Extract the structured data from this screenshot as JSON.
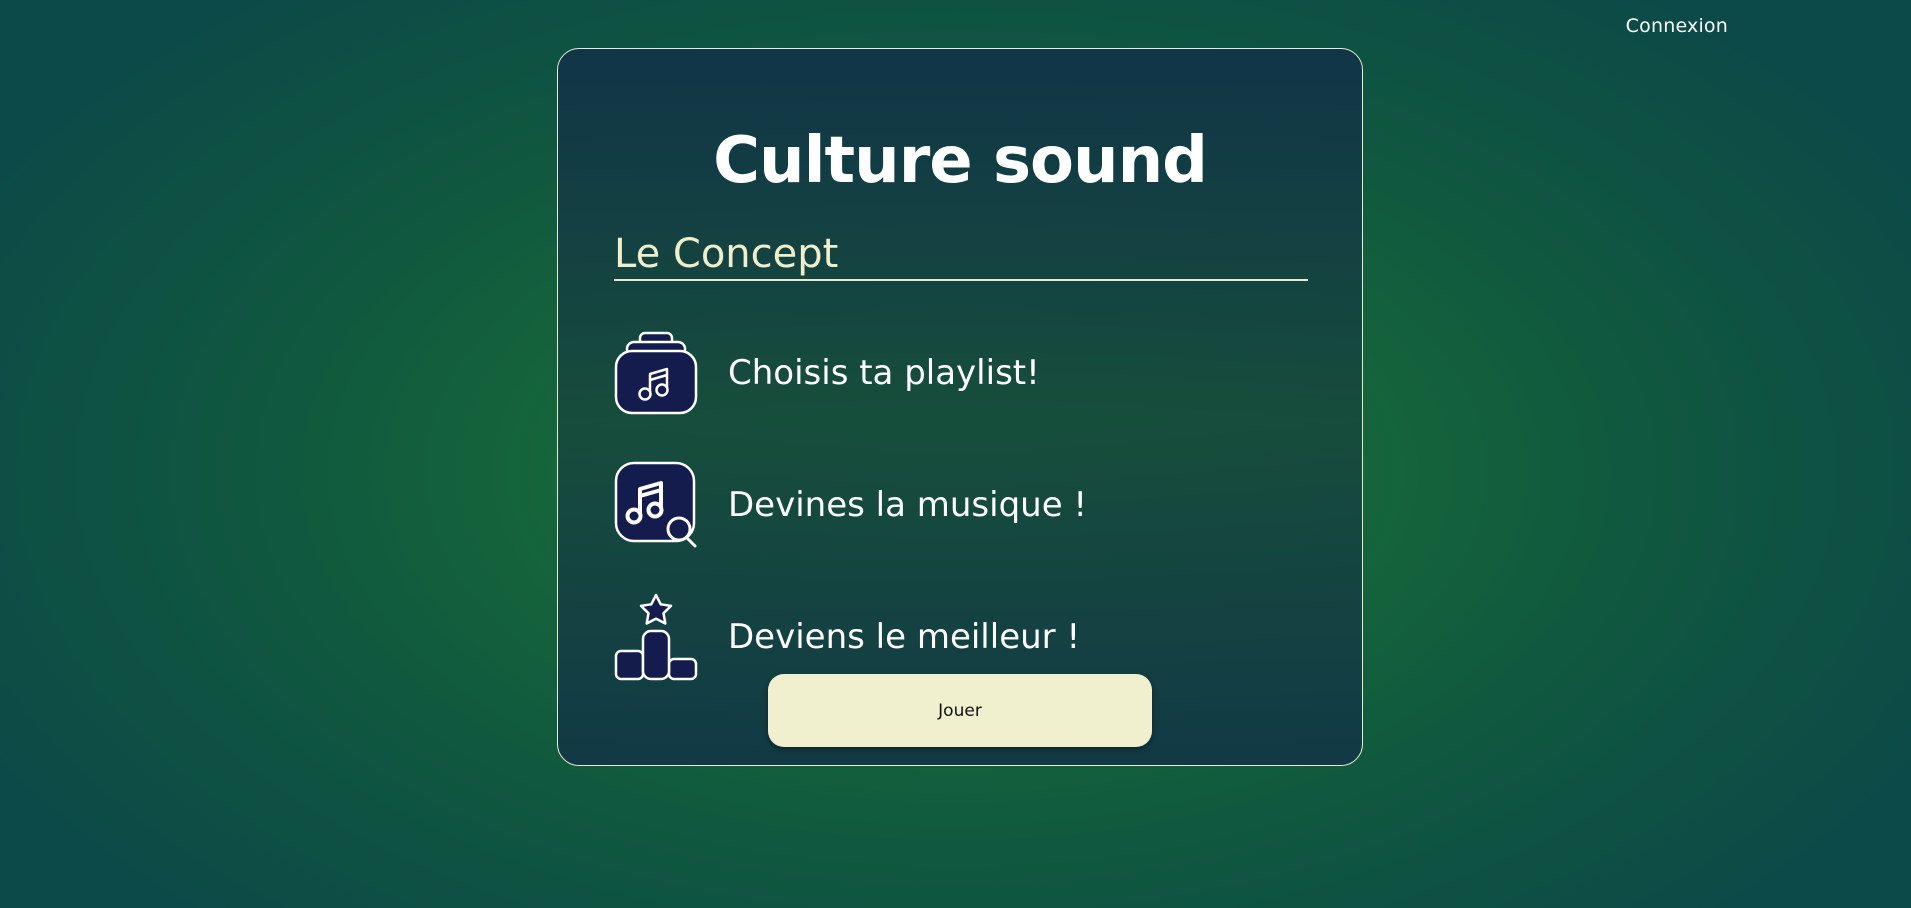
{
  "header": {
    "login_label": "Connexion"
  },
  "card": {
    "title": "Culture sound",
    "concept_heading": "Le Concept",
    "steps": [
      {
        "icon": "music-bag-icon",
        "label": "Choisis ta playlist!"
      },
      {
        "icon": "music-search-icon",
        "label": "Devines la musique !"
      },
      {
        "icon": "podium-star-icon",
        "label": "Deviens le meilleur !"
      }
    ],
    "play_label": "Jouer"
  },
  "colors": {
    "accent_cream": "#f0efce",
    "icon_fill": "#141b4d",
    "background_green": "#1a7a34",
    "background_teal": "#0b4a48"
  }
}
